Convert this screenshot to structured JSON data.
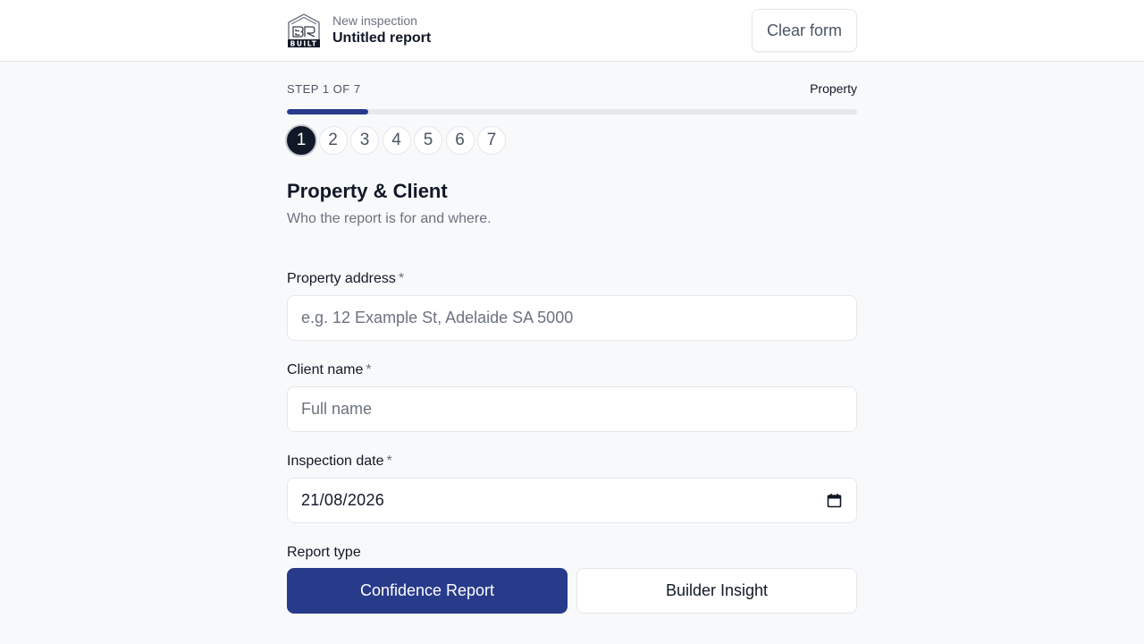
{
  "header": {
    "logo_text": "BUILT",
    "subtitle": "New inspection",
    "title": "Untitled report",
    "clear_label": "Clear form"
  },
  "progress": {
    "step_text": "STEP 1 OF 7",
    "current_step_name": "Property",
    "current": 1,
    "total": 7,
    "steps": [
      "1",
      "2",
      "3",
      "4",
      "5",
      "6",
      "7"
    ],
    "accent_color": "#283a8a"
  },
  "section": {
    "title": "Property & Client",
    "subtitle": "Who the report is for and where."
  },
  "fields": {
    "address": {
      "label": "Property address",
      "required_mark": "*",
      "value": "",
      "placeholder": "e.g. 12 Example St, Adelaide SA 5000"
    },
    "client": {
      "label": "Client name",
      "required_mark": "*",
      "value": "",
      "placeholder": "Full name"
    },
    "date": {
      "label": "Inspection date",
      "required_mark": "*",
      "value": "21/08/2026",
      "icon": "calendar-icon"
    }
  },
  "report_type": {
    "label": "Report type",
    "options": [
      {
        "label": "Confidence Report",
        "selected": true
      },
      {
        "label": "Builder Insight",
        "selected": false
      }
    ]
  }
}
